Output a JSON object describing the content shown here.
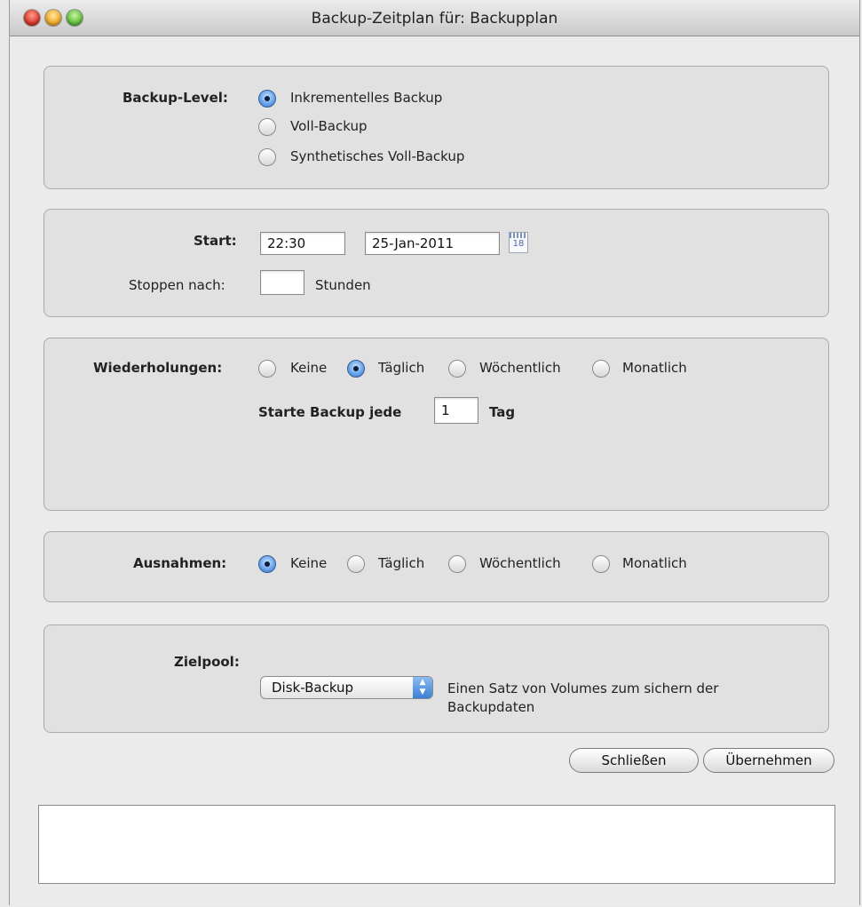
{
  "window": {
    "title": "Backup-Zeitplan für: Backupplan"
  },
  "backup_level": {
    "label": "Backup-Level:",
    "options": [
      "Inkrementelles Backup",
      "Voll-Backup",
      "Synthetisches Voll-Backup"
    ],
    "selected": "Inkrementelles Backup"
  },
  "start": {
    "label": "Start:",
    "time_value": "22:30",
    "date_value": "25-Jan-2011",
    "calendar_icon": "calendar-icon",
    "calendar_text": "18",
    "stop_label": "Stoppen nach:",
    "stop_value": "",
    "stop_unit": "Stunden"
  },
  "repeat": {
    "label": "Wiederholungen:",
    "options": [
      "Keine",
      "Täglich",
      "Wöchentlich",
      "Monatlich"
    ],
    "selected": "Täglich",
    "every_label": "Starte Backup jede",
    "every_value": "1",
    "every_unit": "Tag"
  },
  "exceptions": {
    "label": "Ausnahmen:",
    "options": [
      "Keine",
      "Täglich",
      "Wöchentlich",
      "Monatlich"
    ],
    "selected": "Keine"
  },
  "pool": {
    "label": "Zielpool:",
    "selected": "Disk-Backup",
    "description": "Einen Satz von Volumes zum sichern der",
    "description_line2": "Backupdaten"
  },
  "buttons": {
    "close": "Schließen",
    "apply": "Übernehmen"
  },
  "colors": {
    "radio_selected": "#2c6fc6",
    "panel_bg": "#e1e1e1"
  }
}
